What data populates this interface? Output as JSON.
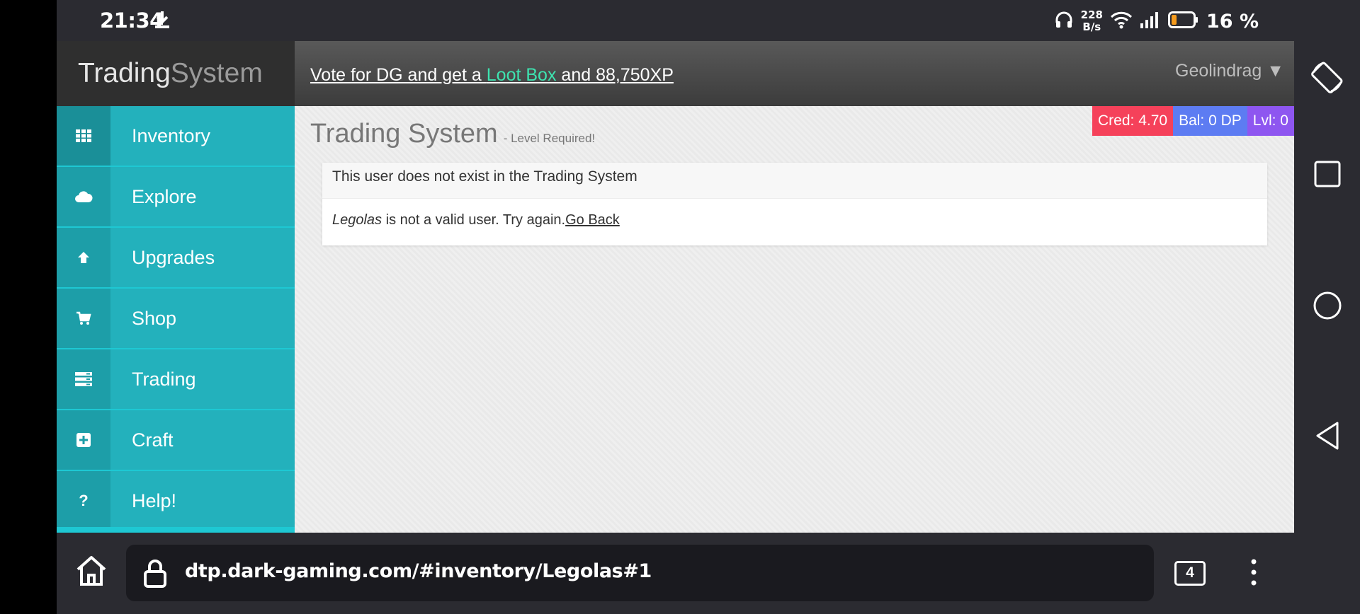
{
  "status": {
    "time": "21:34",
    "net_speed_value": "228",
    "net_speed_unit": "B/s",
    "battery": "16 %"
  },
  "header": {
    "brand_part1": "Trading",
    "brand_part2": "System",
    "vote_prefix": "Vote for DG and get a ",
    "vote_loot": "Loot Box",
    "vote_suffix": " and 88,750XP",
    "username": "Geolindrag ▼"
  },
  "sidebar": {
    "items": [
      {
        "label": "Inventory",
        "icon": "grid-icon"
      },
      {
        "label": "Explore",
        "icon": "cloud-icon"
      },
      {
        "label": "Upgrades",
        "icon": "arrow-up-icon"
      },
      {
        "label": "Shop",
        "icon": "cart-icon"
      },
      {
        "label": "Trading",
        "icon": "server-icon"
      },
      {
        "label": "Craft",
        "icon": "plus-square-icon"
      },
      {
        "label": "Help!",
        "icon": "question-icon"
      }
    ]
  },
  "badges": {
    "cred": "Cred: 4.70",
    "bal": "Bal: 0 DP",
    "lvl": "Lvl: 0"
  },
  "main": {
    "title": "Trading System",
    "subtitle": "- Level Required!",
    "panel_heading": "This user does not exist in the Trading System",
    "user": "Legolas",
    "message": " is not a valid user. Try again.",
    "go_back": "Go Back"
  },
  "browser": {
    "url": "dtp.dark-gaming.com/#inventory/Legolas#1",
    "tab_count": "4"
  },
  "colors": {
    "sidebar": "#23b1bc",
    "cred": "#f5415a",
    "bal": "#5d7cf2",
    "lvl": "#8e56f0",
    "loot": "#3ee3b0"
  }
}
